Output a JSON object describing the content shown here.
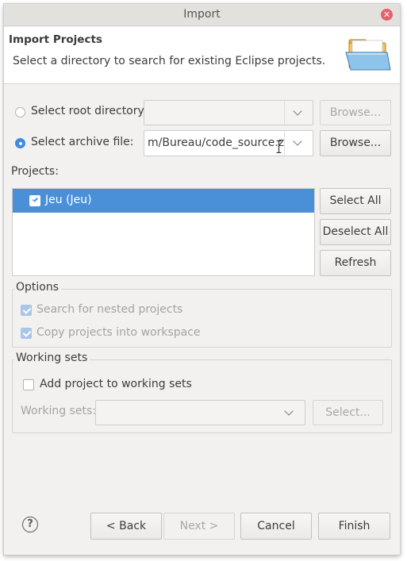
{
  "window": {
    "title": "Import",
    "close_symbol": "✕"
  },
  "header": {
    "title": "Import Projects",
    "description": "Select a directory to search for existing Eclipse projects."
  },
  "source": {
    "root_directory": {
      "label": "Select root directory:",
      "value": "",
      "browse_label": "Browse...",
      "selected": false,
      "enabled": false
    },
    "archive_file": {
      "label": "Select archive file:",
      "value": "m/Bureau/code_source.zip",
      "browse_label": "Browse...",
      "selected": true,
      "enabled": true
    }
  },
  "projects": {
    "label": "Projects:",
    "items": [
      {
        "label": "Jeu (Jeu)",
        "checked": true,
        "selected": true
      }
    ],
    "buttons": {
      "select_all": "Select All",
      "deselect_all": "Deselect All",
      "refresh": "Refresh"
    }
  },
  "options": {
    "legend": "Options",
    "search_nested": {
      "label": "Search for nested projects",
      "checked": true,
      "enabled": false
    },
    "copy_into_workspace": {
      "label": "Copy projects into workspace",
      "checked": true,
      "enabled": false
    }
  },
  "working_sets": {
    "legend": "Working sets",
    "add_to_working_sets": {
      "label": "Add project to working sets",
      "checked": false
    },
    "sets_label": "Working sets:",
    "sets_value": "",
    "select_label": "Select..."
  },
  "footer": {
    "help_symbol": "?",
    "back": "< Back",
    "next": "Next >",
    "cancel": "Cancel",
    "finish": "Finish"
  },
  "colors": {
    "selection": "#4a90d9",
    "checkbox": "#4a90e2",
    "close": "#e65f6c"
  }
}
